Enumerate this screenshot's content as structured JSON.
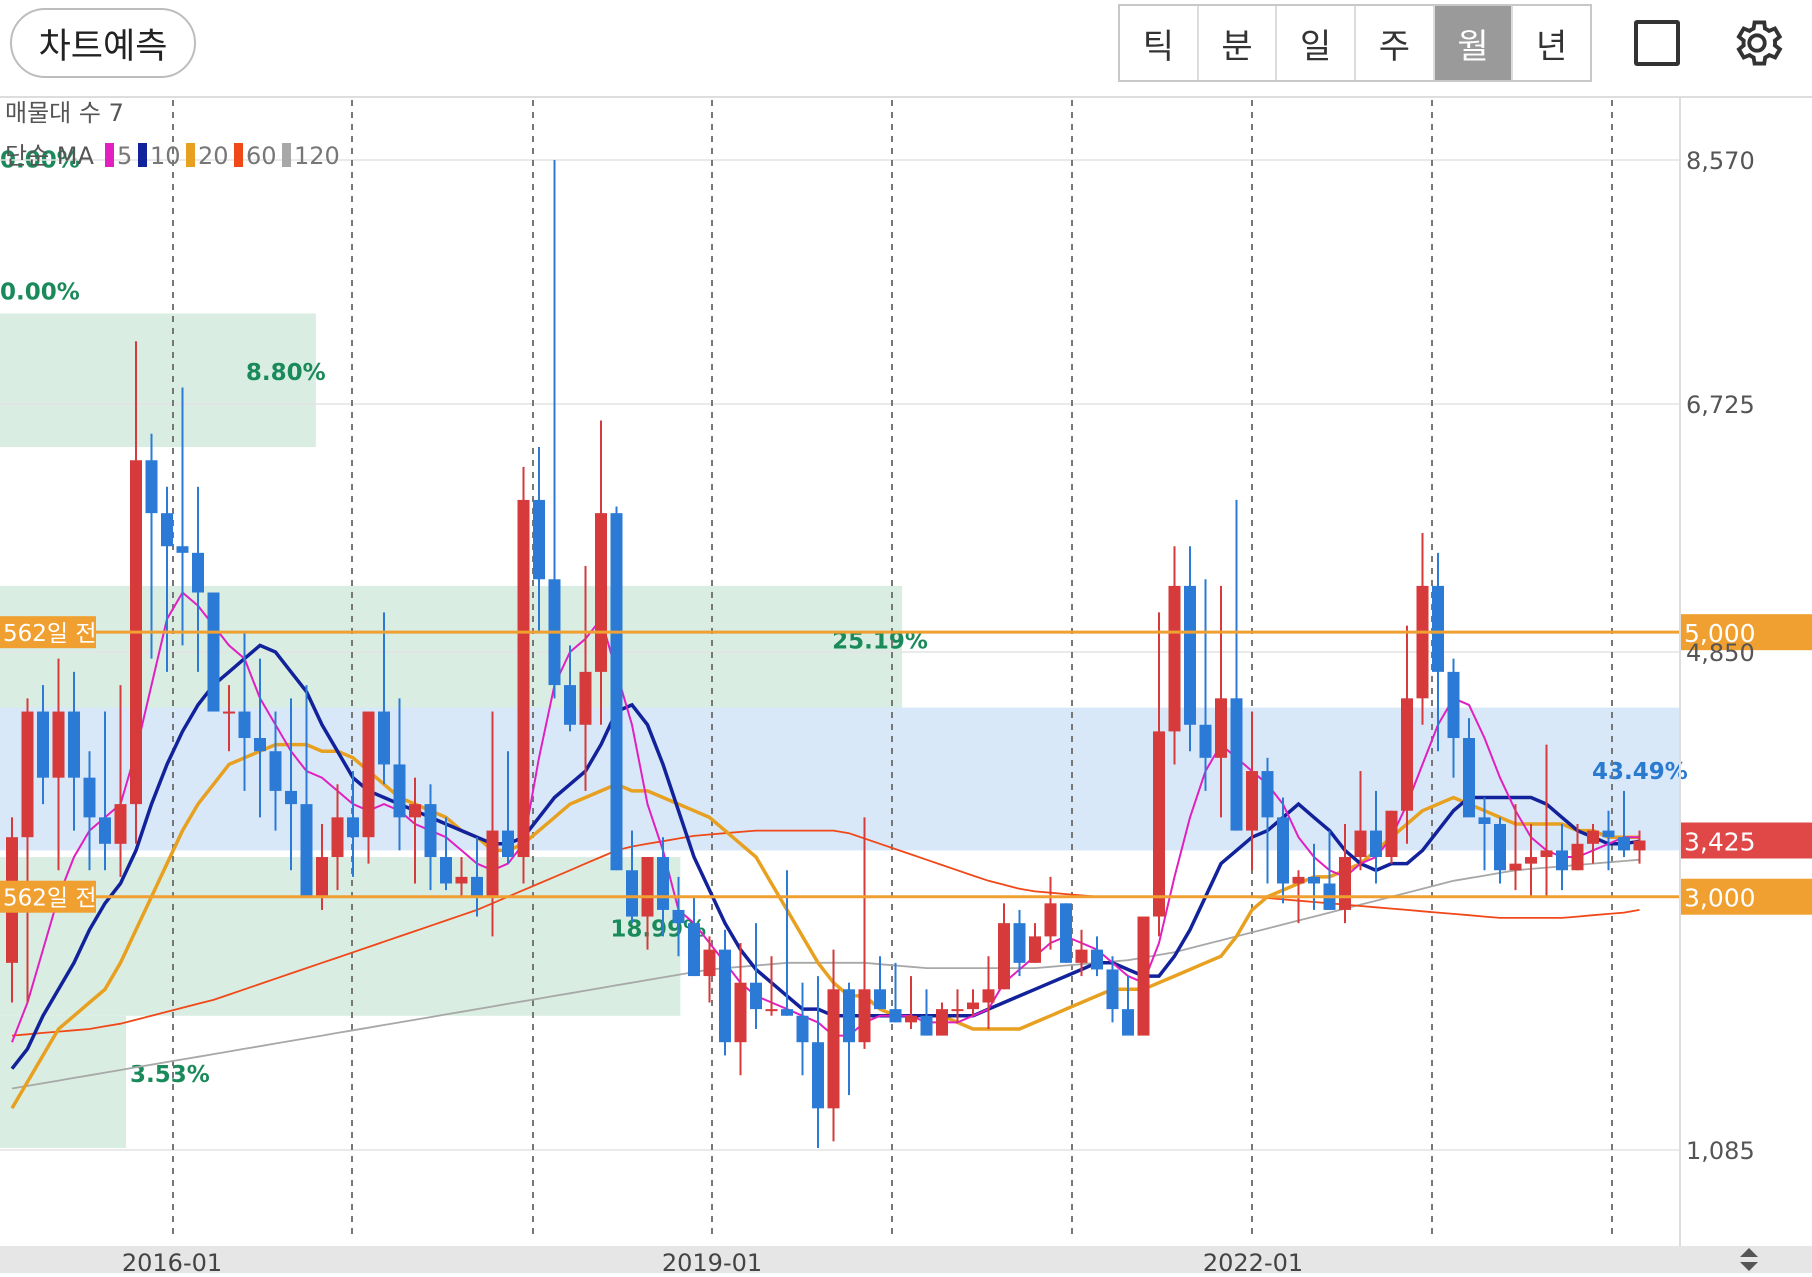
{
  "toolbar": {
    "predict_label": "차트예측",
    "periods": [
      "틱",
      "분",
      "일",
      "주",
      "월",
      "년"
    ],
    "active_period": "월"
  },
  "chart_data": {
    "type": "candlestick",
    "volume_profile_label": "매물대 수 7",
    "ma_legend": {
      "prefix": "단순 MA",
      "items": [
        {
          "label": "5",
          "color": "#e020c0"
        },
        {
          "label": "10",
          "color": "#12229a"
        },
        {
          "label": "20",
          "color": "#e8a020"
        },
        {
          "label": "60",
          "color": "#f04818"
        },
        {
          "label": "120",
          "color": "#a8a8a8"
        }
      ]
    },
    "y_ticks": [
      "8,570",
      "6,725",
      "4,850",
      "1,085"
    ],
    "y_tick_values": [
      8570,
      6725,
      4850,
      1085
    ],
    "x_ticks": [
      "2016-01",
      "2019-01",
      "2022-01"
    ],
    "ylim": [
      560,
      9450
    ],
    "horizontal_lines": [
      {
        "value": 5000,
        "label": "5,000",
        "left_label": "562일 전",
        "color": "#f0a030"
      },
      {
        "value": 3000,
        "label": "3,000",
        "left_label": "562일 전",
        "color": "#f0a030"
      }
    ],
    "current_price": {
      "value": 3425,
      "label": "3,425",
      "color": "#e04848"
    },
    "volume_bands": [
      {
        "low": 6400,
        "high": 7410,
        "right": 0.188,
        "label": "8.80%",
        "color": "green"
      },
      {
        "low": 4400,
        "high": 5350,
        "right": 0.537,
        "label": "25.19%",
        "color": "green"
      },
      {
        "low": 2100,
        "high": 3300,
        "right": 0.405,
        "label": "18.99%",
        "color": "green"
      },
      {
        "low": 3350,
        "high": 4430,
        "right": 1.0,
        "label": "43.49%",
        "color": "blue"
      },
      {
        "low": 1100,
        "high": 2100,
        "right": 0.075,
        "label": "3.53%",
        "color": "green"
      },
      {
        "low": 7700,
        "high": 9450,
        "right": 0,
        "label": "0.00%",
        "color": "green"
      },
      {
        "low": 7450,
        "high": 7700,
        "right": 0,
        "label": "0.00%",
        "color": "green"
      }
    ],
    "candles_note": "monthly OHLC (open, high, low, close)",
    "candles": [
      [
        2500,
        3600,
        2200,
        3450
      ],
      [
        3450,
        4500,
        2200,
        4400
      ],
      [
        4400,
        4600,
        3700,
        3900
      ],
      [
        3900,
        4800,
        3200,
        4400
      ],
      [
        4400,
        4700,
        3500,
        3900
      ],
      [
        3900,
        4100,
        3200,
        3600
      ],
      [
        3600,
        4400,
        3200,
        3400
      ],
      [
        3400,
        4600,
        3150,
        3700
      ],
      [
        3700,
        7200,
        3400,
        6300
      ],
      [
        6300,
        6500,
        4800,
        5900
      ],
      [
        5900,
        6100,
        4700,
        5650
      ],
      [
        5650,
        6850,
        4900,
        5600
      ],
      [
        5600,
        6100,
        4700,
        5300
      ],
      [
        5300,
        5100,
        4400,
        4400
      ],
      [
        4400,
        4600,
        4100,
        4400
      ],
      [
        4400,
        5000,
        3800,
        4200
      ],
      [
        4200,
        4800,
        3600,
        4100
      ],
      [
        4100,
        4400,
        3500,
        3800
      ],
      [
        3800,
        4500,
        3200,
        3700
      ],
      [
        3700,
        4600,
        3300,
        3000
      ],
      [
        3000,
        3550,
        2900,
        3300
      ],
      [
        3300,
        3850,
        3050,
        3600
      ],
      [
        3600,
        3950,
        3150,
        3450
      ],
      [
        3450,
        4300,
        3250,
        4400
      ],
      [
        4400,
        5150,
        3850,
        4000
      ],
      [
        4000,
        4500,
        3350,
        3600
      ],
      [
        3600,
        3900,
        3100,
        3700
      ],
      [
        3700,
        3850,
        3050,
        3300
      ],
      [
        3300,
        3600,
        3050,
        3100
      ],
      [
        3100,
        3300,
        3000,
        3150
      ],
      [
        3150,
        3450,
        2850,
        3000
      ],
      [
        3000,
        4400,
        2700,
        3500
      ],
      [
        3500,
        4100,
        3250,
        3300
      ],
      [
        3300,
        6250,
        3100,
        6000
      ],
      [
        6000,
        6400,
        5000,
        5400
      ],
      [
        5400,
        8570,
        4500,
        4600
      ],
      [
        4600,
        4900,
        4250,
        4300
      ],
      [
        4300,
        5500,
        3800,
        4700
      ],
      [
        4700,
        6600,
        4300,
        5900
      ],
      [
        5900,
        5950,
        3200,
        3200
      ],
      [
        3200,
        3500,
        2800,
        2850
      ],
      [
        2850,
        3300,
        2600,
        3300
      ],
      [
        3300,
        3450,
        2700,
        2900
      ],
      [
        2900,
        3150,
        2550,
        2800
      ],
      [
        2800,
        3000,
        2400,
        2400
      ],
      [
        2400,
        2700,
        2200,
        2600
      ],
      [
        2600,
        2750,
        1800,
        1900
      ],
      [
        1900,
        2650,
        1650,
        2350
      ],
      [
        2350,
        2800,
        2000,
        2150
      ],
      [
        2150,
        2550,
        2100,
        2150
      ],
      [
        2150,
        3200,
        2100,
        2100
      ],
      [
        2100,
        2350,
        1650,
        1900
      ],
      [
        1900,
        2400,
        1100,
        1400
      ],
      [
        1400,
        2600,
        1150,
        2300
      ],
      [
        2300,
        2350,
        1500,
        1900
      ],
      [
        1900,
        3600,
        1850,
        2300
      ],
      [
        2300,
        2550,
        2150,
        2150
      ],
      [
        2150,
        2500,
        2050,
        2050
      ],
      [
        2050,
        2400,
        2000,
        2100
      ],
      [
        2100,
        2300,
        1950,
        1950
      ],
      [
        1950,
        2200,
        1950,
        2150
      ],
      [
        2150,
        2300,
        2050,
        2150
      ],
      [
        2150,
        2300,
        2100,
        2200
      ],
      [
        2200,
        2550,
        2000,
        2300
      ],
      [
        2300,
        2950,
        2300,
        2800
      ],
      [
        2800,
        2900,
        2400,
        2500
      ],
      [
        2500,
        2800,
        2500,
        2700
      ],
      [
        2700,
        3150,
        2600,
        2950
      ],
      [
        2950,
        2950,
        2500,
        2500
      ],
      [
        2500,
        2750,
        2400,
        2600
      ],
      [
        2600,
        2700,
        2400,
        2450
      ],
      [
        2450,
        2550,
        2050,
        2150
      ],
      [
        2150,
        2400,
        2000,
        1950
      ],
      [
        1950,
        2750,
        2000,
        2850
      ],
      [
        2850,
        5150,
        2700,
        4250
      ],
      [
        4250,
        5650,
        4000,
        5350
      ],
      [
        5350,
        5650,
        4100,
        4300
      ],
      [
        4300,
        5400,
        3800,
        4050
      ],
      [
        4050,
        5350,
        3600,
        4500
      ],
      [
        4500,
        6000,
        3500,
        3500
      ],
      [
        3500,
        4400,
        3200,
        3950
      ],
      [
        3950,
        4050,
        3100,
        3600
      ],
      [
        3600,
        3750,
        2950,
        3100
      ],
      [
        3100,
        3200,
        2800,
        3150
      ],
      [
        3150,
        3400,
        2900,
        3100
      ],
      [
        3100,
        3500,
        2900,
        2900
      ],
      [
        2900,
        3550,
        2800,
        3300
      ],
      [
        3300,
        3950,
        3200,
        3500
      ],
      [
        3500,
        3800,
        3100,
        3300
      ],
      [
        3300,
        3650,
        3250,
        3650
      ],
      [
        3650,
        5050,
        3400,
        4500
      ],
      [
        4500,
        5750,
        4300,
        5350
      ],
      [
        5350,
        5600,
        4100,
        4700
      ],
      [
        4700,
        4800,
        3900,
        4200
      ],
      [
        4200,
        4350,
        3800,
        3600
      ],
      [
        3600,
        3750,
        3200,
        3550
      ],
      [
        3550,
        3600,
        3100,
        3200
      ],
      [
        3200,
        3700,
        3050,
        3250
      ],
      [
        3250,
        3550,
        3000,
        3300
      ],
      [
        3300,
        4150,
        3000,
        3350
      ],
      [
        3350,
        3550,
        3050,
        3200
      ],
      [
        3200,
        3550,
        3200,
        3400
      ],
      [
        3400,
        3550,
        3250,
        3500
      ],
      [
        3500,
        3650,
        3200,
        3450
      ],
      [
        3450,
        3800,
        3300,
        3350
      ],
      [
        3350,
        3500,
        3250,
        3425
      ]
    ],
    "moving_averages": [
      {
        "name": "5",
        "color": "#e020c0",
        "width": 2,
        "values": [
          1900,
          2200,
          2600,
          3000,
          3300,
          3500,
          3600,
          3700,
          4100,
          4600,
          5100,
          5300,
          5200,
          5050,
          4900,
          4800,
          4500,
          4300,
          4100,
          3950,
          3900,
          3800,
          3700,
          3650,
          3700,
          3650,
          3550,
          3500,
          3450,
          3350,
          3250,
          3200,
          3250,
          3400,
          4050,
          4600,
          4850,
          4950,
          5100,
          4700,
          4300,
          3700,
          3350,
          2900,
          2800,
          2650,
          2500,
          2350,
          2250,
          2200,
          2150,
          2100,
          2050,
          1950,
          1950,
          2050,
          2100,
          2100,
          2100,
          2050,
          2050,
          2050,
          2100,
          2150,
          2350,
          2450,
          2550,
          2650,
          2700,
          2650,
          2600,
          2500,
          2400,
          2350,
          2650,
          3150,
          3600,
          3950,
          4150,
          4050,
          3950,
          3850,
          3700,
          3450,
          3300,
          3200,
          3150,
          3250,
          3300,
          3450,
          3700,
          4000,
          4300,
          4500,
          4450,
          4200,
          3900,
          3650,
          3450,
          3350,
          3300,
          3300,
          3350,
          3400,
          3450,
          3450
        ]
      },
      {
        "name": "10",
        "color": "#12229a",
        "width": 3.5,
        "values": [
          1700,
          1850,
          2100,
          2300,
          2500,
          2750,
          2950,
          3100,
          3350,
          3700,
          4000,
          4250,
          4450,
          4600,
          4700,
          4800,
          4900,
          4850,
          4700,
          4550,
          4300,
          4100,
          3900,
          3800,
          3750,
          3700,
          3650,
          3600,
          3550,
          3500,
          3450,
          3400,
          3400,
          3450,
          3600,
          3750,
          3850,
          3950,
          4150,
          4400,
          4450,
          4300,
          4000,
          3650,
          3300,
          3050,
          2800,
          2600,
          2450,
          2350,
          2250,
          2150,
          2150,
          2100,
          2100,
          2100,
          2100,
          2100,
          2100,
          2100,
          2100,
          2100,
          2100,
          2150,
          2200,
          2250,
          2300,
          2350,
          2400,
          2450,
          2500,
          2500,
          2450,
          2400,
          2400,
          2550,
          2750,
          3000,
          3250,
          3350,
          3450,
          3500,
          3600,
          3700,
          3600,
          3500,
          3350,
          3250,
          3200,
          3250,
          3250,
          3350,
          3500,
          3650,
          3750,
          3750,
          3750,
          3750,
          3750,
          3700,
          3600,
          3500,
          3450,
          3400,
          3400,
          3420
        ]
      },
      {
        "name": "20",
        "color": "#e8a020",
        "width": 3.5,
        "values": [
          1400,
          1600,
          1800,
          2000,
          2100,
          2200,
          2300,
          2500,
          2750,
          3000,
          3250,
          3500,
          3700,
          3850,
          4000,
          4050,
          4100,
          4150,
          4150,
          4150,
          4100,
          4100,
          4050,
          3950,
          3850,
          3750,
          3700,
          3650,
          3600,
          3500,
          3450,
          3350,
          3350,
          3400,
          3500,
          3600,
          3700,
          3750,
          3800,
          3850,
          3800,
          3800,
          3750,
          3700,
          3650,
          3600,
          3500,
          3400,
          3300,
          3100,
          2900,
          2700,
          2500,
          2350,
          2250,
          2250,
          2150,
          2100,
          2100,
          2100,
          2100,
          2050,
          2000,
          2000,
          2000,
          2000,
          2050,
          2100,
          2150,
          2200,
          2250,
          2300,
          2300,
          2300,
          2350,
          2400,
          2450,
          2500,
          2550,
          2700,
          2900,
          3000,
          3050,
          3100,
          3150,
          3150,
          3200,
          3250,
          3350,
          3450,
          3550,
          3650,
          3700,
          3750,
          3700,
          3650,
          3600,
          3550,
          3550,
          3550,
          3550,
          3500,
          3500,
          3450,
          3450,
          3450
        ]
      },
      {
        "name": "60",
        "color": "#f04818",
        "width": 1.8,
        "values": [
          1950,
          1960,
          1970,
          1980,
          1990,
          2000,
          2020,
          2040,
          2070,
          2100,
          2130,
          2160,
          2190,
          2220,
          2260,
          2300,
          2340,
          2380,
          2420,
          2460,
          2500,
          2540,
          2580,
          2620,
          2660,
          2700,
          2740,
          2780,
          2820,
          2860,
          2900,
          2950,
          3000,
          3050,
          3100,
          3150,
          3200,
          3250,
          3300,
          3350,
          3380,
          3400,
          3420,
          3440,
          3460,
          3470,
          3480,
          3490,
          3500,
          3500,
          3500,
          3500,
          3500,
          3500,
          3480,
          3440,
          3400,
          3360,
          3320,
          3280,
          3240,
          3200,
          3160,
          3120,
          3090,
          3060,
          3040,
          3030,
          3020,
          3010,
          3000,
          3000,
          3000,
          3000,
          3000,
          3000,
          3000,
          3000,
          3000,
          3000,
          3000,
          2990,
          2980,
          2970,
          2960,
          2950,
          2940,
          2930,
          2920,
          2910,
          2900,
          2890,
          2880,
          2870,
          2860,
          2850,
          2840,
          2840,
          2840,
          2840,
          2840,
          2850,
          2860,
          2870,
          2880,
          2900
        ]
      },
      {
        "name": "120",
        "color": "#a8a8a8",
        "width": 1.8,
        "values": [
          1550,
          1570,
          1590,
          1610,
          1630,
          1650,
          1670,
          1690,
          1710,
          1730,
          1750,
          1770,
          1790,
          1810,
          1830,
          1850,
          1870,
          1890,
          1910,
          1930,
          1950,
          1970,
          1990,
          2010,
          2030,
          2050,
          2070,
          2090,
          2110,
          2130,
          2150,
          2170,
          2190,
          2210,
          2230,
          2250,
          2270,
          2290,
          2310,
          2330,
          2350,
          2370,
          2390,
          2410,
          2430,
          2450,
          2460,
          2470,
          2480,
          2490,
          2500,
          2500,
          2500,
          2500,
          2500,
          2500,
          2490,
          2480,
          2470,
          2460,
          2460,
          2460,
          2460,
          2460,
          2460,
          2460,
          2460,
          2470,
          2480,
          2490,
          2500,
          2510,
          2520,
          2540,
          2560,
          2580,
          2610,
          2640,
          2670,
          2700,
          2730,
          2760,
          2790,
          2820,
          2850,
          2880,
          2910,
          2940,
          2970,
          3000,
          3030,
          3060,
          3090,
          3120,
          3140,
          3160,
          3180,
          3200,
          3210,
          3220,
          3230,
          3240,
          3250,
          3260,
          3270,
          3280
        ]
      }
    ]
  }
}
